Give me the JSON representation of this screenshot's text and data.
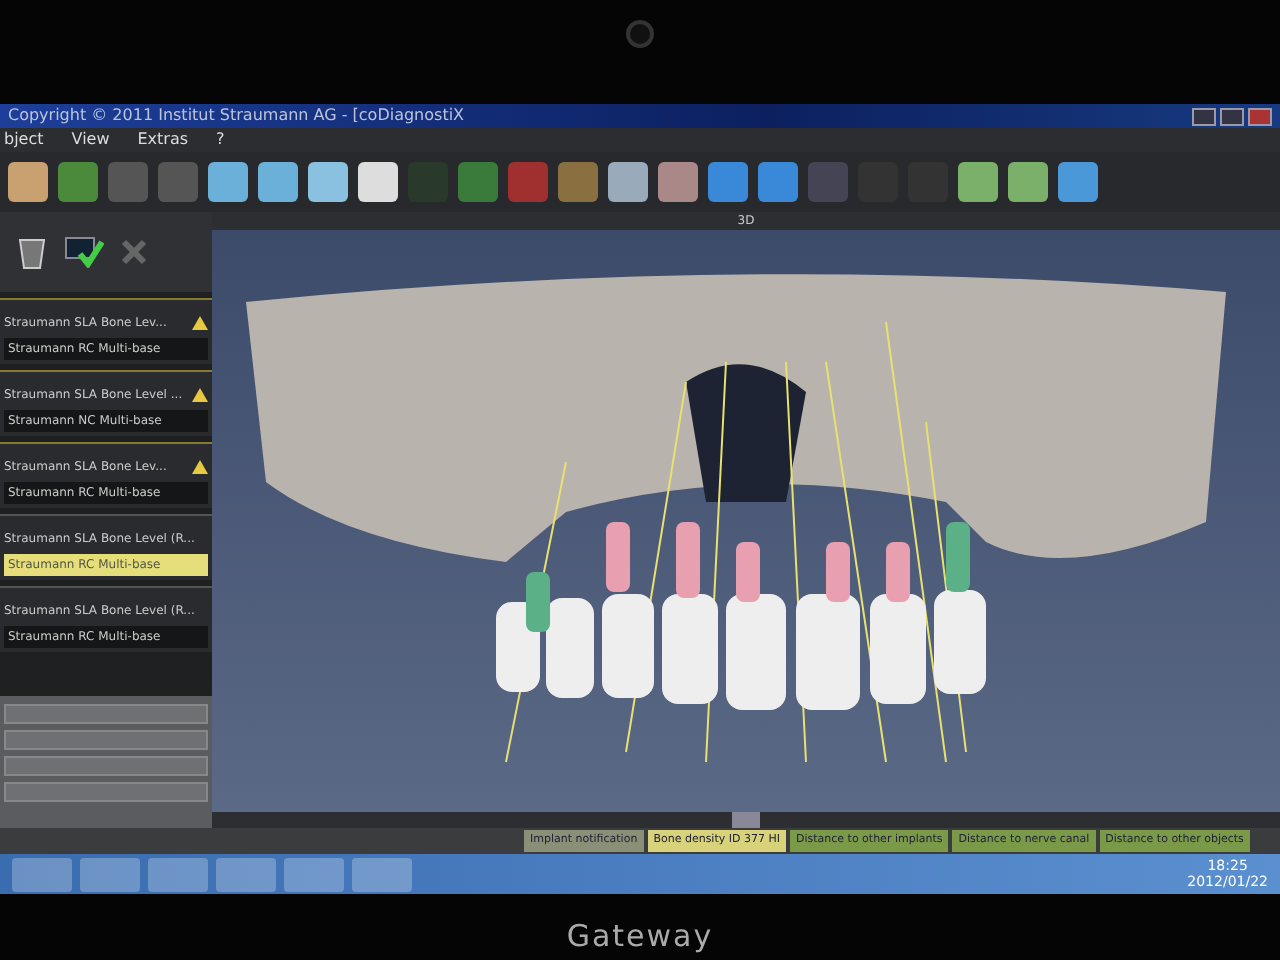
{
  "window": {
    "title": "Copyright © 2011 Institut Straumann AG - [coDiagnostiX"
  },
  "menu": [
    {
      "label": "bject"
    },
    {
      "label": "View"
    },
    {
      "label": "Extras"
    },
    {
      "label": "?"
    }
  ],
  "implants": [
    {
      "name": "Straumann SLA Bone Lev...",
      "abutment": "Straumann RC Multi-base",
      "warning": true,
      "selected": false
    },
    {
      "name": "Straumann SLA Bone Level ...",
      "abutment": "Straumann NC Multi-base",
      "warning": true,
      "selected": false
    },
    {
      "name": "Straumann SLA Bone Lev...",
      "abutment": "Straumann RC Multi-base",
      "warning": true,
      "selected": false
    },
    {
      "name": "Straumann SLA Bone Level (R...",
      "abutment": "Straumann RC Multi-base",
      "warning": false,
      "selected": true
    },
    {
      "name": "Straumann SLA Bone Level (R...",
      "abutment": "Straumann RC Multi-base",
      "warning": false,
      "selected": false
    }
  ],
  "view": {
    "title": "3D"
  },
  "status_bar": [
    {
      "label": "Implant notification",
      "color": "#8a8f78"
    },
    {
      "label": "Bone density ID 377 HI",
      "color": "#d8d27a"
    },
    {
      "label": "Distance to other implants",
      "color": "#7a9a4a"
    },
    {
      "label": "Distance to nerve canal",
      "color": "#7a9a4a"
    },
    {
      "label": "Distance to other objects",
      "color": "#7a9a4a"
    }
  ],
  "taskbar": {
    "time": "18:25",
    "date": "2012/01/22"
  },
  "bezel": {
    "brand": "Gateway"
  }
}
